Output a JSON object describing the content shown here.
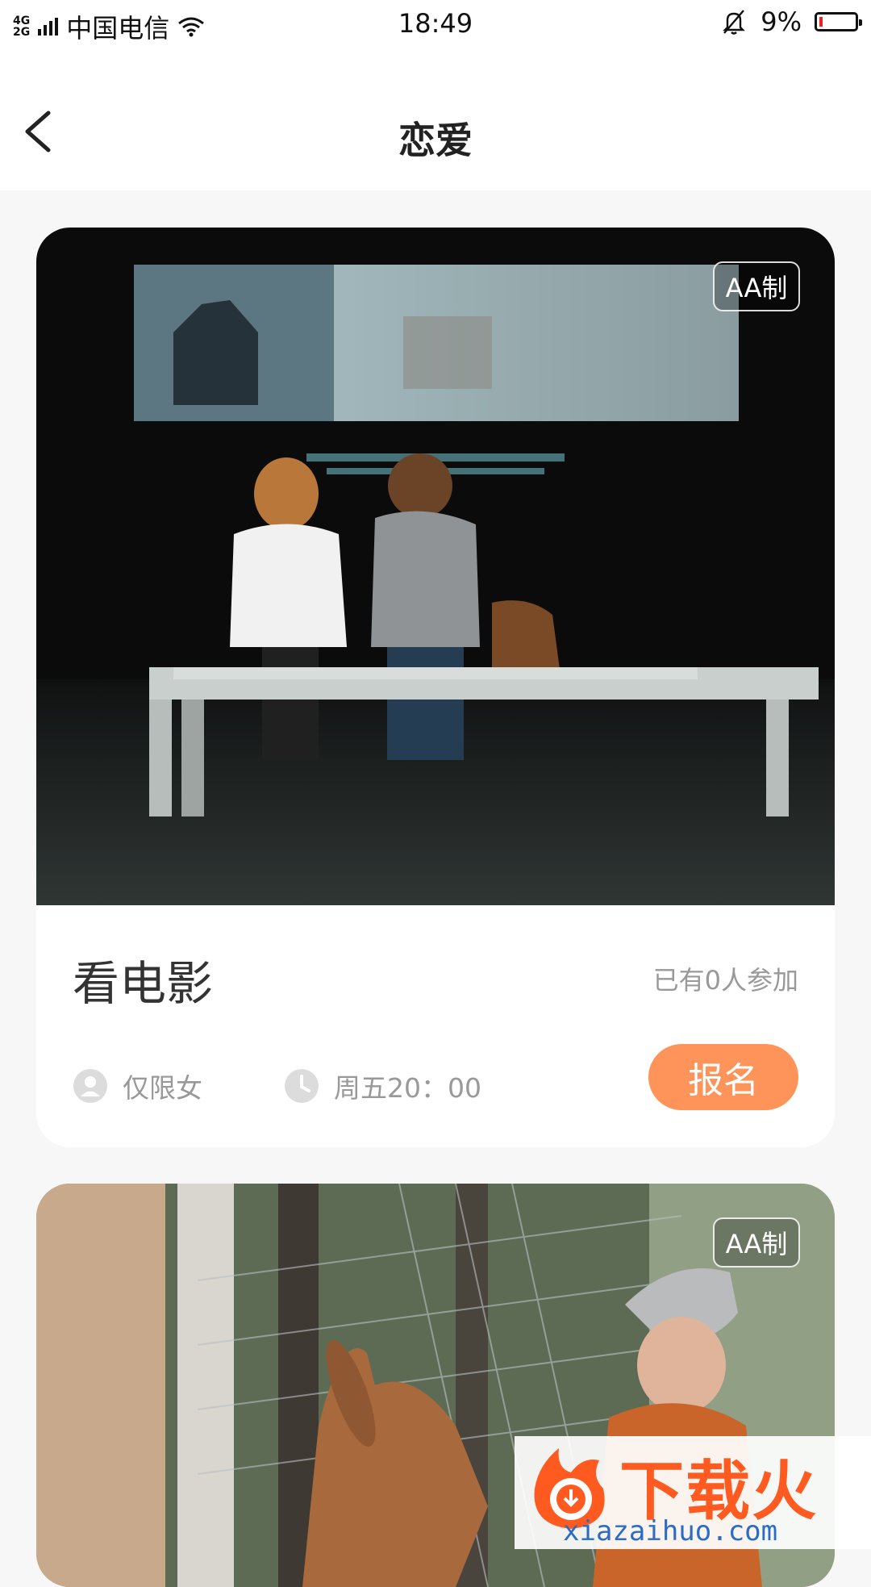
{
  "status_bar": {
    "network_types": [
      "4G",
      "2G"
    ],
    "carrier": "中国电信",
    "time": "18:49",
    "battery_percent": "9%",
    "battery_level": 0.09,
    "icons": [
      "signal-icon",
      "wifi-icon",
      "bell-muted-icon",
      "battery-icon"
    ]
  },
  "nav": {
    "title": "恋爱",
    "back_icon": "chevron-left-icon"
  },
  "cards": [
    {
      "badge": "AA制",
      "title": "看电影",
      "joined": "已有0人参加",
      "gender": "仅限女",
      "time": "周五20：00",
      "button": "报名"
    },
    {
      "badge": "AA制"
    }
  ],
  "watermark": {
    "text": "下载火",
    "url": "xiazaihuo.com"
  },
  "colors": {
    "accent": "#ff945a",
    "muted_text": "#999999",
    "background": "#f7f7f7",
    "watermark_orange": "#ff5a1f",
    "watermark_blue": "#2b6cc4"
  }
}
